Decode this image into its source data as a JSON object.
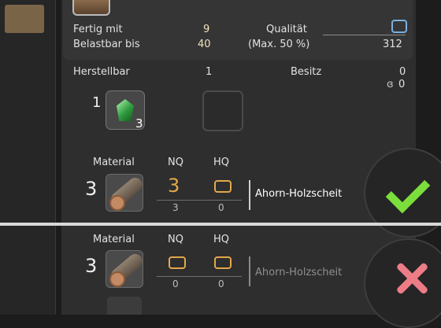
{
  "stats": {
    "done_label": "Fertig mit",
    "done_value": "9",
    "load_label": "Belastbar bis",
    "load_value": "40",
    "quality_label": "Qualität",
    "quality_max_label": "(Max. 50 %)",
    "quality_value": "312"
  },
  "craft": {
    "craftable_label": "Herstellbar",
    "craftable_value": "1",
    "owned_label": "Besitz",
    "owned_value": "0",
    "owned_hq_value": "0",
    "crystal_amount": "1",
    "crystal_count": "3",
    "crystal_icon": "green-crystal-icon"
  },
  "materials": [
    {
      "header_material": "Material",
      "header_nq": "NQ",
      "header_hq": "HQ",
      "required": "3",
      "nq_selected": "3",
      "hq_selected": "0",
      "nq_owned": "3",
      "hq_owned": "0",
      "name": "Ahorn-Holzscheit",
      "icon": "maple-log-icon"
    },
    {
      "header_material": "Material",
      "header_nq": "NQ",
      "header_hq": "HQ",
      "required": "3",
      "nq_selected": "",
      "hq_selected": "",
      "nq_owned": "0",
      "hq_owned": "0",
      "name": "Ahorn-Holzscheit",
      "icon": "maple-log-icon"
    }
  ],
  "colors": {
    "confirm": "#7cde3c",
    "cancel": "#ec7c86",
    "nq_box": "#e3a84a",
    "quality_box": "#7ab0e0"
  }
}
